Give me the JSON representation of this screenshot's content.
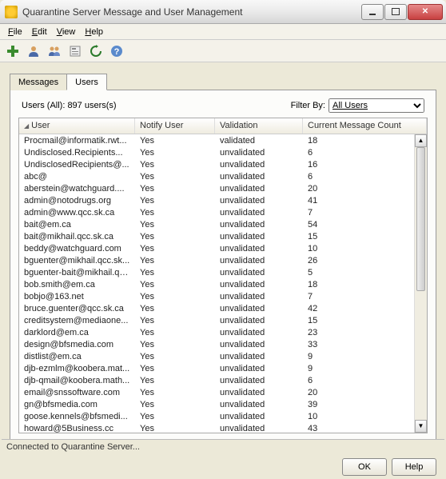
{
  "window": {
    "title": "Quarantine Server Message and User Management"
  },
  "menu": {
    "file": "File",
    "edit": "Edit",
    "view": "View",
    "help": "Help"
  },
  "tabs": {
    "messages": "Messages",
    "users": "Users"
  },
  "panel": {
    "summary": "Users (All):  897 users(s)",
    "filter_label": "Filter By:",
    "filter_value": "All Users"
  },
  "columns": {
    "user": "User",
    "notify": "Notify User",
    "validation": "Validation",
    "count": "Current Message Count"
  },
  "rows": [
    {
      "user": "Procmail@informatik.rwt...",
      "notify": "Yes",
      "validation": "validated",
      "count": "18"
    },
    {
      "user": "Undisclosed.Recipients...",
      "notify": "Yes",
      "validation": "unvalidated",
      "count": "6"
    },
    {
      "user": "UndisclosedRecipients@...",
      "notify": "Yes",
      "validation": "unvalidated",
      "count": "16"
    },
    {
      "user": "abc@",
      "notify": "Yes",
      "validation": "unvalidated",
      "count": "6"
    },
    {
      "user": "aberstein@watchguard....",
      "notify": "Yes",
      "validation": "unvalidated",
      "count": "20"
    },
    {
      "user": "admin@notodrugs.org",
      "notify": "Yes",
      "validation": "unvalidated",
      "count": "41"
    },
    {
      "user": "admin@www.qcc.sk.ca",
      "notify": "Yes",
      "validation": "unvalidated",
      "count": "7"
    },
    {
      "user": "bait@em.ca",
      "notify": "Yes",
      "validation": "unvalidated",
      "count": "54"
    },
    {
      "user": "bait@mikhail.qcc.sk.ca",
      "notify": "Yes",
      "validation": "unvalidated",
      "count": "15"
    },
    {
      "user": "beddy@watchguard.com",
      "notify": "Yes",
      "validation": "unvalidated",
      "count": "10"
    },
    {
      "user": "bguenter@mikhail.qcc.sk...",
      "notify": "Yes",
      "validation": "unvalidated",
      "count": "26"
    },
    {
      "user": "bguenter-bait@mikhail.qc...",
      "notify": "Yes",
      "validation": "unvalidated",
      "count": "5"
    },
    {
      "user": "bob.smith@em.ca",
      "notify": "Yes",
      "validation": "unvalidated",
      "count": "18"
    },
    {
      "user": "bobjo@163.net",
      "notify": "Yes",
      "validation": "unvalidated",
      "count": "7"
    },
    {
      "user": "bruce.guenter@qcc.sk.ca",
      "notify": "Yes",
      "validation": "unvalidated",
      "count": "42"
    },
    {
      "user": "creditsystem@mediaone...",
      "notify": "Yes",
      "validation": "unvalidated",
      "count": "15"
    },
    {
      "user": "darklord@em.ca",
      "notify": "Yes",
      "validation": "unvalidated",
      "count": "23"
    },
    {
      "user": "design@bfsmedia.com",
      "notify": "Yes",
      "validation": "unvalidated",
      "count": "33"
    },
    {
      "user": "distlist@em.ca",
      "notify": "Yes",
      "validation": "unvalidated",
      "count": "9"
    },
    {
      "user": "djb-ezmlm@koobera.mat...",
      "notify": "Yes",
      "validation": "unvalidated",
      "count": "9"
    },
    {
      "user": "djb-qmail@koobera.math...",
      "notify": "Yes",
      "validation": "unvalidated",
      "count": "6"
    },
    {
      "user": "email@snssoftware.com",
      "notify": "Yes",
      "validation": "unvalidated",
      "count": "20"
    },
    {
      "user": "gn@bfsmedia.com",
      "notify": "Yes",
      "validation": "unvalidated",
      "count": "39"
    },
    {
      "user": "goose.kennels@bfsmedi...",
      "notify": "Yes",
      "validation": "unvalidated",
      "count": "10"
    },
    {
      "user": "howard@5Business.cc",
      "notify": "Yes",
      "validation": "unvalidated",
      "count": "43"
    }
  ],
  "buttons": {
    "ok": "OK",
    "help": "Help"
  },
  "status": "Connected to Quarantine Server..."
}
